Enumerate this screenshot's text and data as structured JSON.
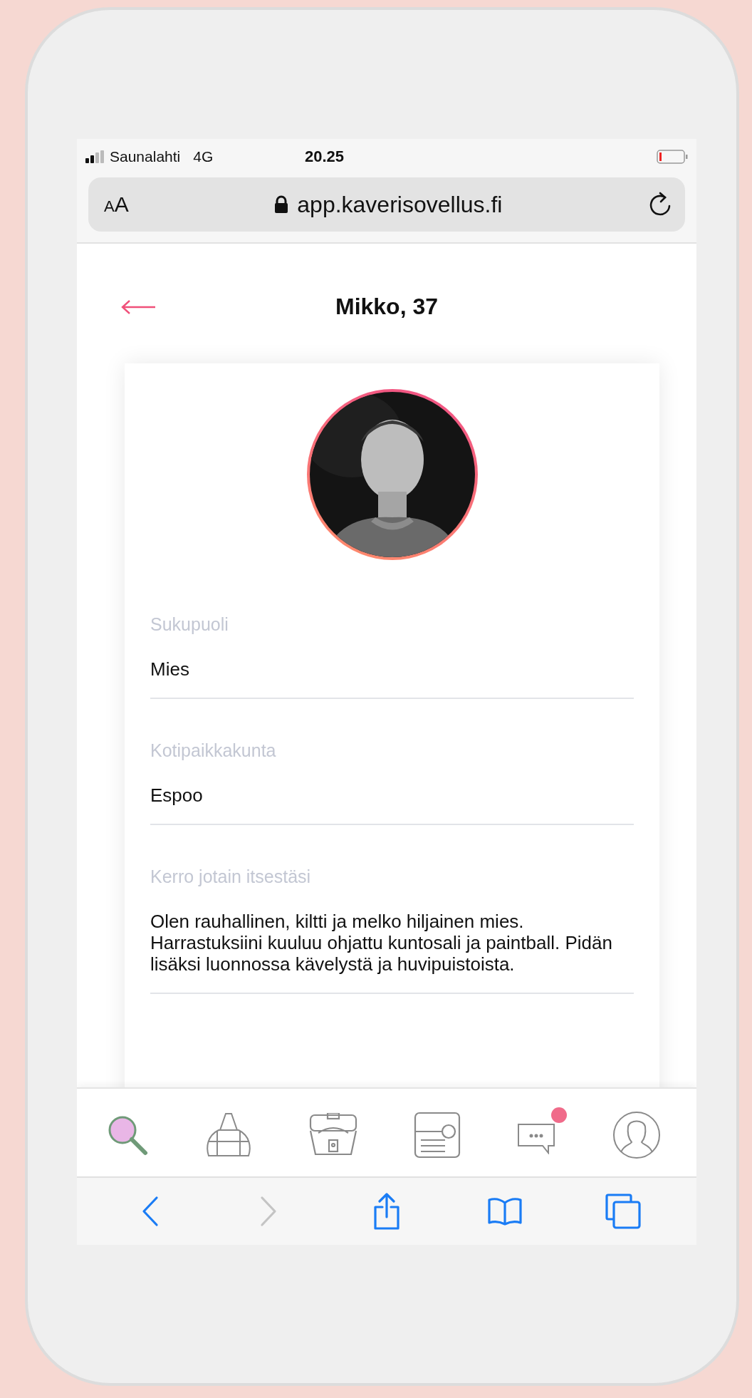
{
  "status_bar": {
    "carrier": "Saunalahti",
    "network": "4G",
    "time": "20.25"
  },
  "address_bar": {
    "text_size_button": "AA",
    "url": "app.kaverisovellus.fi"
  },
  "page": {
    "title": "Mikko, 37",
    "fields": [
      {
        "label": "Sukupuoli",
        "value": "Mies"
      },
      {
        "label": "Kotipaikkakunta",
        "value": "Espoo"
      },
      {
        "label": "Kerro jotain itsestäsi",
        "value": "Olen rauhallinen, kiltti ja melko hiljainen mies. Harrastuksiini kuuluu ohjattu kuntosali ja paintball. Pidän lisäksi luonnossa kävelystä ja huvipuistoista."
      }
    ]
  },
  "tab_bar": {
    "items": [
      {
        "kind": "search",
        "selected": true,
        "notification": false
      },
      {
        "kind": "bag",
        "selected": false,
        "notification": false
      },
      {
        "kind": "chest",
        "selected": false,
        "notification": false
      },
      {
        "kind": "card",
        "selected": false,
        "notification": false
      },
      {
        "kind": "chat",
        "selected": false,
        "notification": true
      },
      {
        "kind": "profile",
        "selected": false,
        "notification": false
      }
    ]
  },
  "browser_toolbar": {
    "items": [
      {
        "kind": "back",
        "disabled": false
      },
      {
        "kind": "forward",
        "disabled": true
      },
      {
        "kind": "share",
        "disabled": false
      },
      {
        "kind": "bookmarks",
        "disabled": false
      },
      {
        "kind": "tabs",
        "disabled": false
      }
    ]
  }
}
